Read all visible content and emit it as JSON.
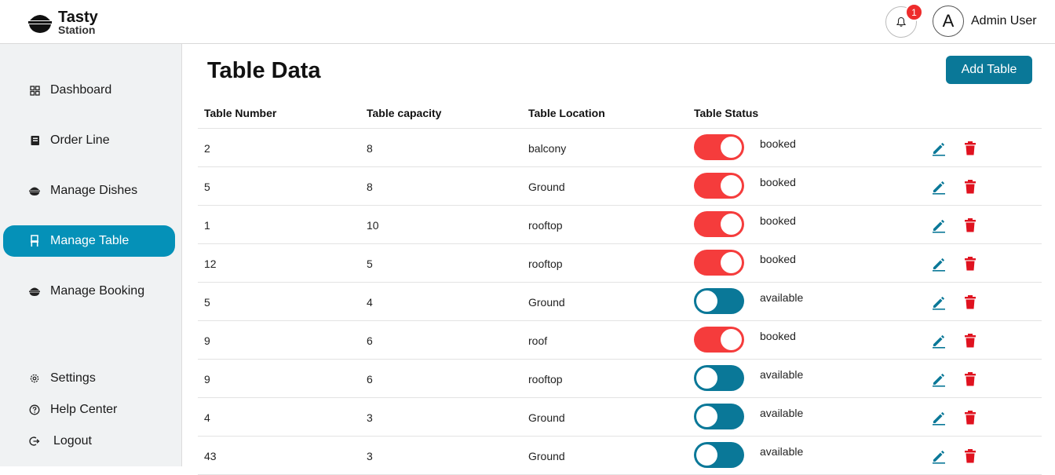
{
  "brand": {
    "title": "Tasty",
    "subtitle": "Station"
  },
  "header": {
    "notification_count": "1",
    "avatar_letter": "A",
    "user_name": "Admin User"
  },
  "sidebar": {
    "items": [
      {
        "label": "Dashboard",
        "icon": "grid-icon"
      },
      {
        "label": "Order Line",
        "icon": "book-icon"
      },
      {
        "label": "Manage Dishes",
        "icon": "bowl-icon"
      },
      {
        "label": "Manage Table",
        "icon": "chair-icon",
        "active": true
      },
      {
        "label": "Manage Booking",
        "icon": "bowl-icon"
      }
    ],
    "bottom": [
      {
        "label": "Settings",
        "icon": "gear-icon"
      },
      {
        "label": "Help Center",
        "icon": "help-icon"
      },
      {
        "label": "Logout",
        "icon": "logout-icon"
      }
    ]
  },
  "main": {
    "title": "Table Data",
    "add_button": "Add Table",
    "columns": [
      "Table Number",
      "Table capacity",
      "Table Location",
      "Table Status"
    ],
    "rows": [
      {
        "number": "2",
        "capacity": "8",
        "location": "balcony",
        "status": "booked"
      },
      {
        "number": "5",
        "capacity": "8",
        "location": "Ground",
        "status": "booked"
      },
      {
        "number": "1",
        "capacity": "10",
        "location": "rooftop",
        "status": "booked"
      },
      {
        "number": "12",
        "capacity": "5",
        "location": "rooftop",
        "status": "booked"
      },
      {
        "number": "5",
        "capacity": "4",
        "location": "Ground",
        "status": "available"
      },
      {
        "number": "9",
        "capacity": "6",
        "location": "roof",
        "status": "booked"
      },
      {
        "number": "9",
        "capacity": "6",
        "location": "rooftop",
        "status": "available"
      },
      {
        "number": "4",
        "capacity": "3",
        "location": "Ground",
        "status": "available"
      },
      {
        "number": "43",
        "capacity": "3",
        "location": "Ground",
        "status": "available"
      }
    ]
  },
  "colors": {
    "accent": "#0591b8",
    "button": "#0a7898",
    "toggle_on": "#f53c3c",
    "toggle_off": "#0a7898",
    "edit_icon": "#0a7898",
    "delete_icon": "#e0121f",
    "badge": "#ee2b2b"
  }
}
